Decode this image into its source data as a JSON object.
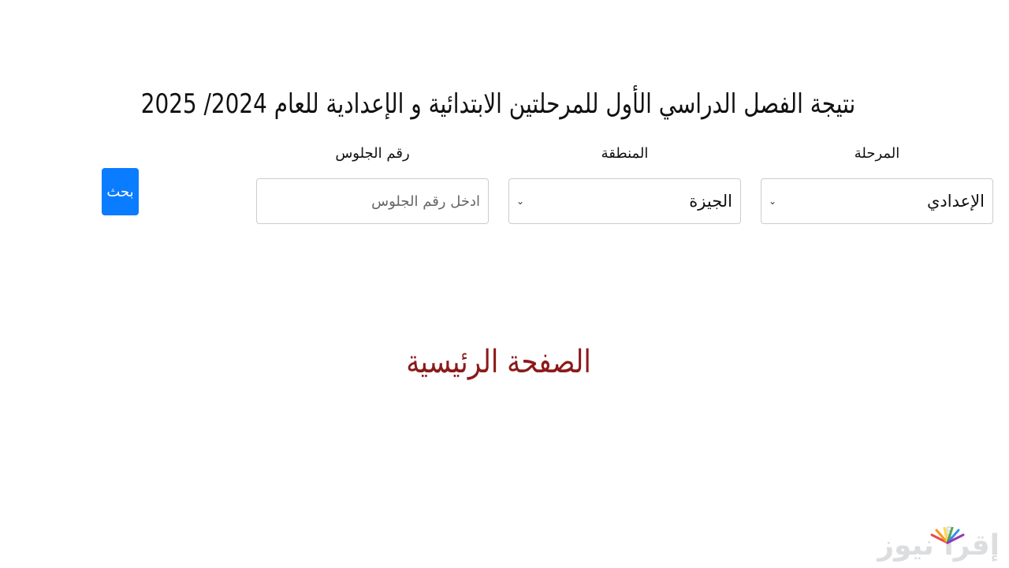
{
  "header": {
    "title": "نتيجة الفصل الدراسي الأول للمرحلتين الابتدائية و الإعدادية للعام 2024/ 2025"
  },
  "form": {
    "stage": {
      "label": "المرحلة",
      "selected": "الإعدادي"
    },
    "region": {
      "label": "المنطقة",
      "selected": "الجيزة"
    },
    "seat": {
      "label": "رقم الجلوس",
      "placeholder": "ادخل رقم الجلوس",
      "value": ""
    },
    "search_label": "بحث"
  },
  "home_link": "الصفحة الرئيسية",
  "watermark": {
    "text": "إقرأ نيوز"
  },
  "colors": {
    "accent": "#0a7cff",
    "home_link": "#8b1a1a"
  }
}
